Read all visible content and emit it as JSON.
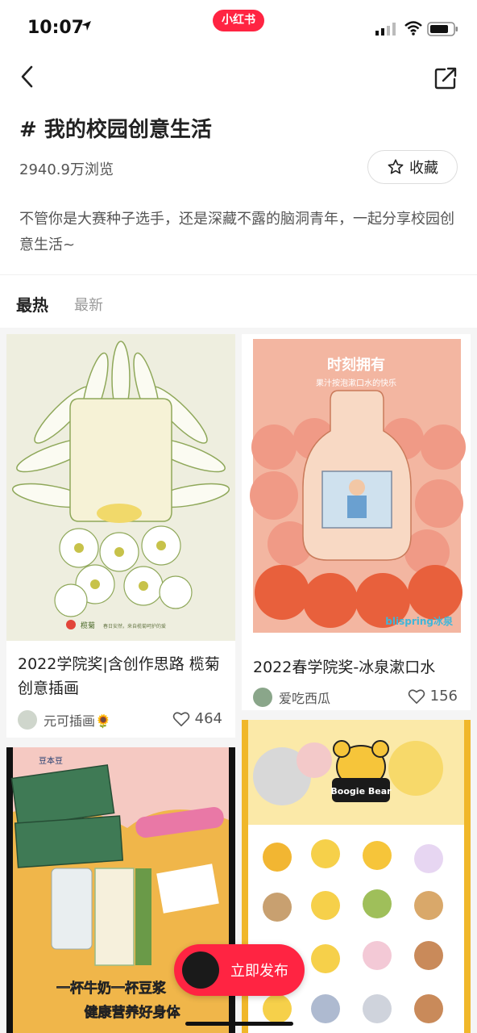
{
  "status_bar": {
    "time": "10:07",
    "brand": "小红书"
  },
  "topic": {
    "title": "# 我的校园创意生活",
    "views": "2940.9万浏览",
    "favorite_label": "收藏",
    "description": "不管你是大赛种子选手，还是深藏不露的脑洞青年，一起分享校园创意生活~"
  },
  "tabs": [
    {
      "label": "最热"
    },
    {
      "label": "最新"
    }
  ],
  "posts": [
    {
      "title": "2022学院奖|含创作思路 榄菊创意插画",
      "author": "元可插画🌻",
      "likes": "464",
      "image_brand": "榄菊",
      "image_caption": "春日安然，来自榄菊呵护的爱"
    },
    {
      "title": "2022春学院奖-冰泉漱口水",
      "author": "爱吃西瓜",
      "likes": "156",
      "image_heading": "时刻拥有",
      "image_subheading": "果汁按泡漱口水的快乐",
      "image_brand": "blispring冰泉"
    },
    {
      "image_brand": "豆本豆",
      "image_slogan_1": "一杯牛奶一杯豆浆",
      "image_slogan_2": "健康营养好身体"
    },
    {
      "image_brand": "Boogie Bear"
    }
  ],
  "publish_button": {
    "label": "立即发布"
  },
  "colors": {
    "accent": "#ff2442",
    "background": "#ffffff",
    "feed_background": "#f5f5f5"
  }
}
